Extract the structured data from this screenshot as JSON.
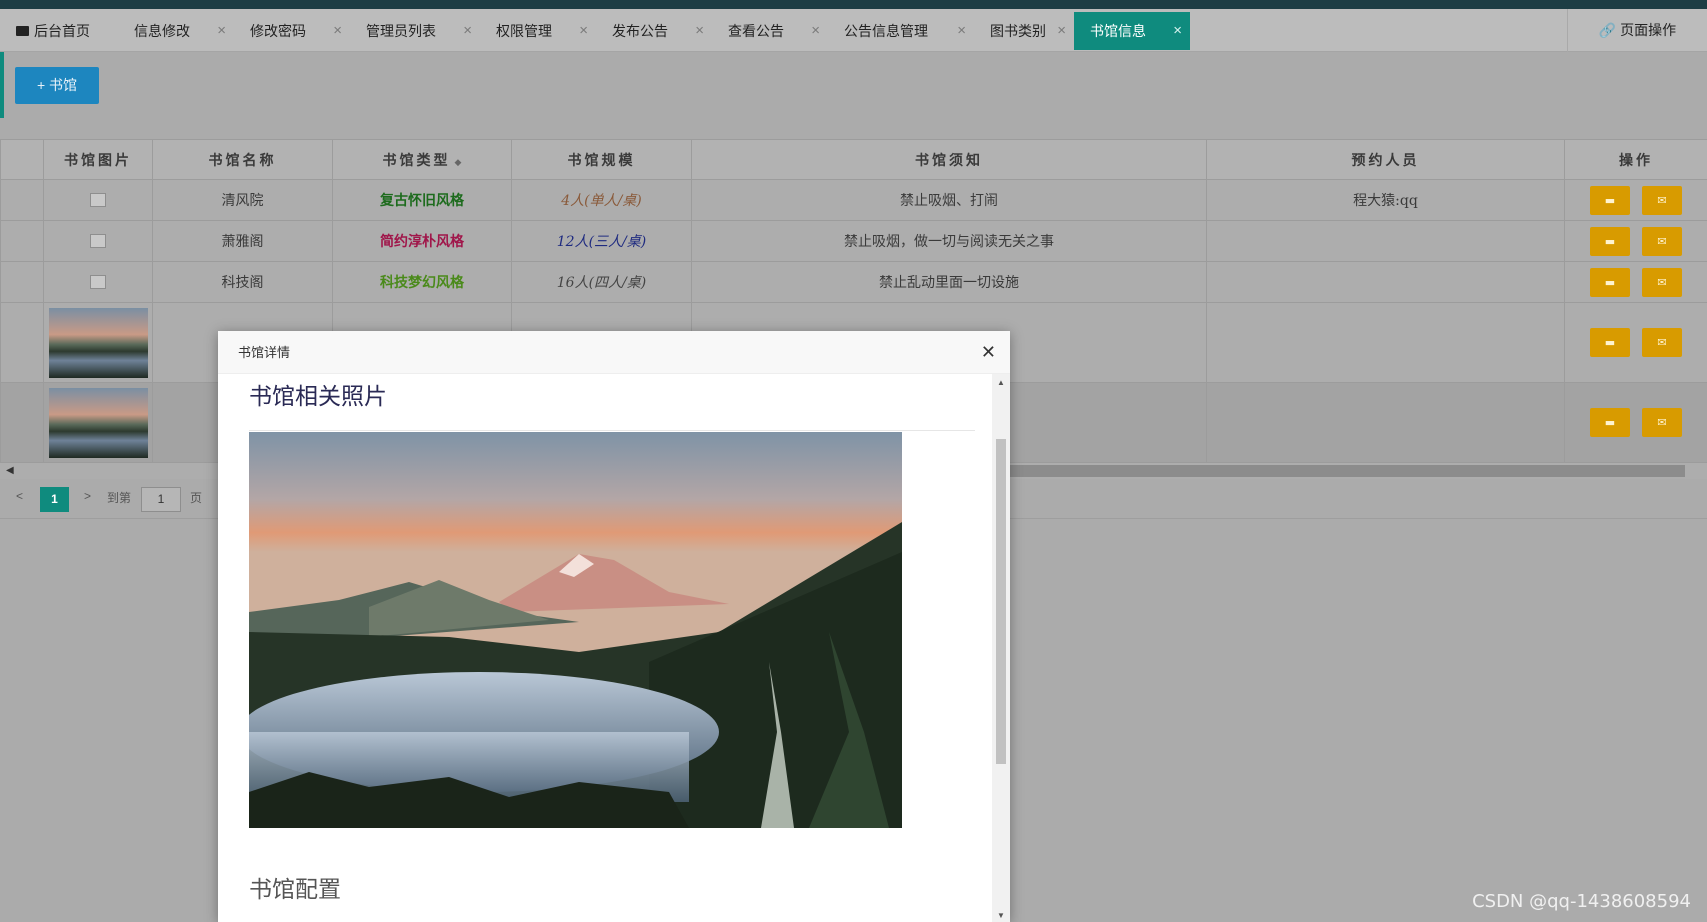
{
  "tabs": [
    {
      "label": "后台首页",
      "closable": false,
      "active": false
    },
    {
      "label": "信息修改",
      "closable": true,
      "active": false
    },
    {
      "label": "修改密码",
      "closable": true,
      "active": false
    },
    {
      "label": "管理员列表",
      "closable": true,
      "active": false
    },
    {
      "label": "权限管理",
      "closable": true,
      "active": false
    },
    {
      "label": "发布公告",
      "closable": true,
      "active": false
    },
    {
      "label": "查看公告",
      "closable": true,
      "active": false
    },
    {
      "label": "公告信息管理",
      "closable": true,
      "active": false
    },
    {
      "label": "图书类别",
      "closable": true,
      "active": false
    },
    {
      "label": "书馆信息",
      "closable": true,
      "active": true
    }
  ],
  "tab_close_glyph": "×",
  "page_operations": "页面操作",
  "add_button": "+ 书馆",
  "table": {
    "headers": [
      "书馆图片",
      "书馆名称",
      "书馆类型",
      "书馆规模",
      "书馆须知",
      "预约人员",
      "操作"
    ],
    "rows": [
      {
        "name": "清风院",
        "type": "复古怀旧风格",
        "type_color": "#1d6b1d",
        "scale": "4人(单人/桌)",
        "scale_color": "#8a5a3a",
        "notice": "禁止吸烟、打闹",
        "reservation": "程大猿:qq",
        "image": "broken"
      },
      {
        "name": "萧雅阁",
        "type": "简约淳朴风格",
        "type_color": "#a0164a",
        "scale": "12人(三人/桌)",
        "scale_color": "#1f2b80",
        "notice": "禁止吸烟，做一切与阅读无关之事",
        "reservation": "",
        "image": "broken"
      },
      {
        "name": "科技阁",
        "type": "科技梦幻风格",
        "type_color": "#4a8a1a",
        "scale": "16人(四人/桌)",
        "scale_color": "#444444",
        "notice": "禁止乱动里面一切设施",
        "reservation": "",
        "image": "broken"
      },
      {
        "name": "",
        "type": "",
        "type_color": "#333333",
        "scale": "",
        "scale_color": "#333333",
        "notice": "",
        "reservation": "",
        "image": "thumb"
      },
      {
        "name": "",
        "type": "",
        "type_color": "#333333",
        "scale": "",
        "scale_color": "#333333",
        "notice": "",
        "reservation": "",
        "image": "thumb"
      }
    ]
  },
  "pagination": {
    "current": "1",
    "goto_label": "到第",
    "goto_value": "1",
    "page_suffix": "页"
  },
  "modal": {
    "title": "书馆详情",
    "section_photos": "书馆相关照片",
    "section_config": "书馆配置"
  },
  "watermark": "CSDN @qq-1438608594",
  "colors": {
    "accent": "#0f8b7e",
    "primary_button": "#1d86bf",
    "op_button": "#d89b00"
  }
}
